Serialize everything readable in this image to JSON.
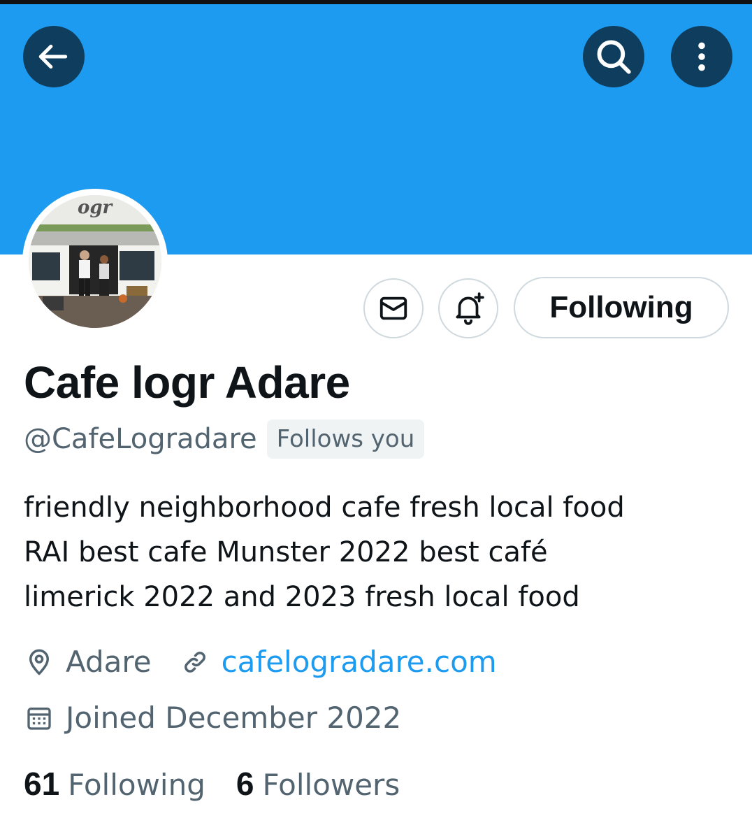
{
  "colors": {
    "banner": "#1d9bf0",
    "header_button_bg": "#0f3d5e",
    "text_primary": "#0f1419",
    "text_secondary": "#536471",
    "link": "#1d9bf0",
    "button_border": "#cfd9de"
  },
  "header": {
    "back_icon": "arrow-left-icon",
    "search_icon": "search-icon",
    "more_icon": "more-vertical-icon"
  },
  "profile": {
    "avatar_icon": "cafe-storefront-photo",
    "name": "Cafe logr Adare",
    "handle": "@CafeLogradare",
    "follows_you_badge": "Follows you",
    "bio_lines": [
      "friendly neighborhood cafe fresh local food",
      "RAI best cafe Munster 2022 best café",
      "limerick 2022 and 2023 fresh local food"
    ],
    "location": "Adare",
    "website": "cafelogradare.com",
    "joined": "Joined December 2022"
  },
  "actions": {
    "message_icon": "envelope-icon",
    "notify_icon": "bell-plus-icon",
    "following_label": "Following"
  },
  "stats": {
    "following_count": "61",
    "following_label": "Following",
    "followers_count": "6",
    "followers_label": "Followers"
  }
}
